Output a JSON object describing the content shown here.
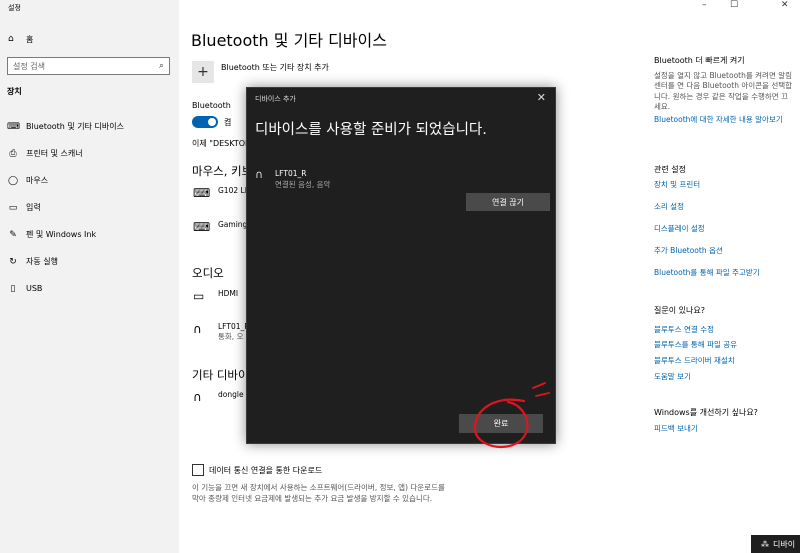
{
  "app": {
    "title": "설정"
  },
  "window_controls": {
    "minimize": "–",
    "maximize": "☐",
    "close": "✕"
  },
  "sidebar": {
    "home": {
      "icon": "home-icon",
      "label": "홈"
    },
    "search_placeholder": "설정 검색",
    "section": "장치",
    "items": [
      {
        "icon": "bluetooth-devices-icon",
        "label": "Bluetooth 및 기타 디바이스"
      },
      {
        "icon": "printer-icon",
        "label": "프린터 및 스캐너"
      },
      {
        "icon": "mouse-icon",
        "label": "마우스"
      },
      {
        "icon": "keyboard-icon",
        "label": "입력"
      },
      {
        "icon": "pen-icon",
        "label": "펜 및 Windows Ink"
      },
      {
        "icon": "autoplay-icon",
        "label": "자동 실행"
      },
      {
        "icon": "usb-icon",
        "label": "USB"
      }
    ]
  },
  "main": {
    "title": "Bluetooth 및 기타 디바이스",
    "add_label": "Bluetooth 또는 기타 장치 추가",
    "bluetooth_label": "Bluetooth",
    "toggle_label": "켬",
    "discoverable_text": "이제 \"DESKTOP",
    "sections": {
      "mouse": {
        "heading": "마우스, 키보",
        "devices": [
          {
            "name": "G102 LI",
            "icon": "keyboard-icon"
          },
          {
            "name": "Gaming",
            "icon": "keyboard-icon"
          }
        ]
      },
      "audio": {
        "heading": "오디오",
        "devices": [
          {
            "name": "HDMI",
            "icon": "monitor-icon"
          },
          {
            "name": "LFT01_R",
            "sub": "통화, 오",
            "icon": "headphones-icon"
          }
        ]
      },
      "other": {
        "heading": "기타 디바이",
        "devices": [
          {
            "name": "dongle",
            "icon": "headset-icon"
          }
        ]
      }
    },
    "metered": {
      "label": "데이터 통신 연결을 통한 다운로드",
      "desc": "이 기능을 끄면 새 장치에서 사용하는 소프트웨어(드라이버, 정보, 앱) 다운로드를 막아 종량제 인터넷 요금제에 발생되는 추가 요금 발생을 방지할 수 있습니다."
    }
  },
  "right_panel": {
    "quick": {
      "heading": "Bluetooth 더 빠르게 켜기",
      "text": "설정을 열지 않고 Bluetooth를 켜려면 알림 센터를 연 다음 Bluetooth 아이콘을 선택합니다. 원하는 경우 같은 작업을 수행하면 끄세요.",
      "link": "Bluetooth에 대한 자세한 내용 알아보기"
    },
    "related": {
      "heading": "관련 설정",
      "links": [
        "장치 및 프린터",
        "소리 설정",
        "디스플레이 설정",
        "추가 Bluetooth 옵션",
        "Bluetooth를 통해 파일 주고받기"
      ]
    },
    "help": {
      "heading": "질문이 있나요?",
      "links": [
        "블루투스 연결 수정",
        "블루투스를 통해 파일 공유",
        "블루투스 드라이버 재설치",
        "도움말 보기"
      ]
    },
    "feedback": {
      "heading": "Windows를 개선하기 싶나요?",
      "link": "피드백 보내기"
    }
  },
  "dialog": {
    "title": "디바이스 추가",
    "close": "✕",
    "heading": "디바이스를 사용할 준비가 되었습니다.",
    "device": {
      "name": "LFT01_R",
      "sub": "연결된 음성, 음악",
      "icon": "headphones-icon"
    },
    "disconnect_label": "연결 끊기",
    "done_label": "완료",
    "annotation_color": "#e0141e"
  },
  "toast": {
    "label": "디바이"
  }
}
